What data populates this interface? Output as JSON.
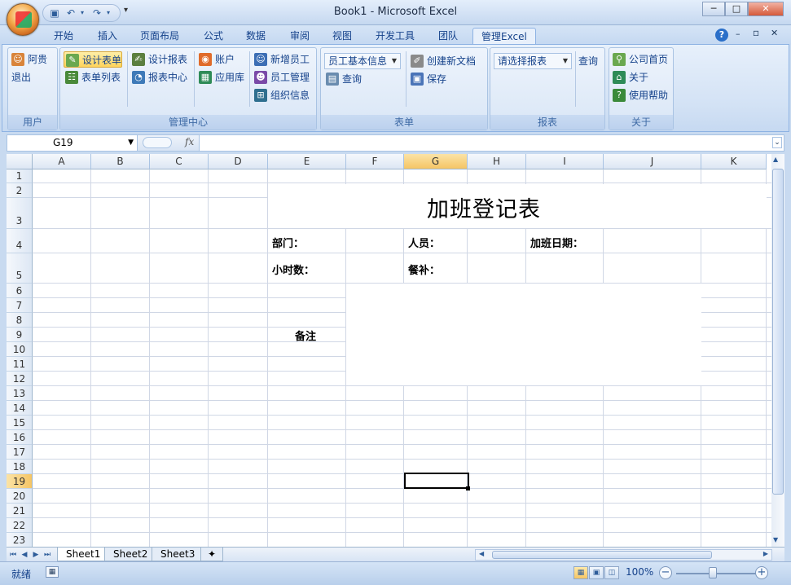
{
  "window": {
    "title": "Book1 - Microsoft Excel",
    "min": "─",
    "max": "□",
    "close": "✕"
  },
  "qat": {
    "customize": "▾"
  },
  "tabs": [
    "开始",
    "插入",
    "页面布局",
    "公式",
    "数据",
    "审阅",
    "视图",
    "开发工具",
    "团队",
    "管理Excel"
  ],
  "active_tab": "管理Excel",
  "ribbon_right": {
    "help": "?",
    "min": "–",
    "restore": "▫",
    "close": "✕"
  },
  "ribbon": {
    "user": {
      "label": "用户",
      "name": "阿贵",
      "logout": "退出"
    },
    "manage": {
      "label": "管理中心",
      "design_form": "设计表单",
      "form_list": "表单列表",
      "design_report": "设计报表",
      "report_center": "报表中心",
      "account": "账户",
      "app_store": "应用库",
      "new_employee": "新增员工",
      "employee_mgmt": "员工管理",
      "org_info": "组织信息"
    },
    "form": {
      "label": "表单",
      "dropdown": "员工基本信息",
      "query": "查询",
      "create_doc": "创建新文档",
      "save": "保存"
    },
    "report": {
      "label": "报表",
      "dropdown": "请选择报表",
      "query": "查询"
    },
    "about": {
      "label": "关于",
      "homepage": "公司首页",
      "about": "关于",
      "help": "使用帮助"
    }
  },
  "formula_bar": {
    "name_box": "G19",
    "fx": "fx",
    "value": ""
  },
  "columns": [
    "A",
    "B",
    "C",
    "D",
    "E",
    "F",
    "G",
    "H",
    "I",
    "J",
    "K"
  ],
  "rows": [
    "1",
    "2",
    "3",
    "4",
    "5",
    "6",
    "7",
    "8",
    "9",
    "10",
    "11",
    "12",
    "13",
    "14",
    "15",
    "16",
    "17",
    "18",
    "19",
    "20",
    "21",
    "22",
    "23"
  ],
  "selected_cell": {
    "column": "G",
    "row": "19"
  },
  "sheet": {
    "title": "加班登记表",
    "department_label": "部门：",
    "person_label": "人员：",
    "date_label": "加班日期：",
    "hours_label": "小时数：",
    "meal_label": "餐补：",
    "remarks_label": "备注"
  },
  "sheet_tabs": [
    "Sheet1",
    "Sheet2",
    "Sheet3"
  ],
  "status": {
    "ready": "就绪",
    "zoom": "100%"
  },
  "colors": {
    "accent": "#15428b",
    "ribbon_bg": "#d3e2f5",
    "selected_header": "#f5c565"
  }
}
